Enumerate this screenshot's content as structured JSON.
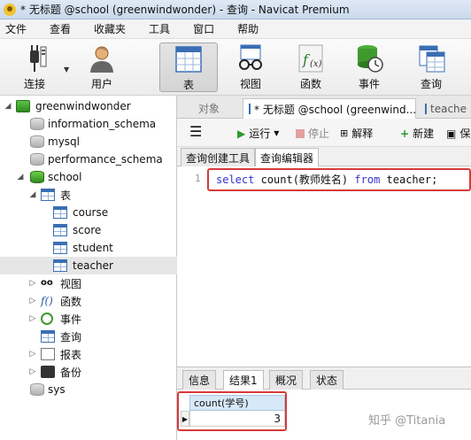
{
  "window": {
    "title": "* 无标题 @school (greenwindwonder) - 查询 - Navicat Premium"
  },
  "menu": [
    "文件",
    "查看",
    "收藏夹",
    "工具",
    "窗口",
    "帮助"
  ],
  "toolbar": {
    "items": [
      {
        "label": "连接",
        "icon": "plug-icon"
      },
      {
        "label": "用户",
        "icon": "user-icon"
      },
      {
        "label": "表",
        "icon": "table-icon"
      },
      {
        "label": "视图",
        "icon": "view-glasses-icon"
      },
      {
        "label": "函数",
        "icon": "function-icon"
      },
      {
        "label": "事件",
        "icon": "event-icon"
      },
      {
        "label": "查询",
        "icon": "query-icon"
      }
    ],
    "active": "表"
  },
  "tree": {
    "connection": "greenwindwonder",
    "databases_top": [
      "information_schema",
      "mysql",
      "performance_schema"
    ],
    "school": "school",
    "tables_label": "表",
    "tables": [
      "course",
      "score",
      "student",
      "teacher"
    ],
    "selected_table": "teacher",
    "sub_nodes": [
      "视图",
      "函数",
      "事件",
      "查询",
      "报表",
      "备份"
    ],
    "databases_bottom": [
      "sys"
    ]
  },
  "tabs": {
    "objects": "对象",
    "query_tab": "* 无标题 @school (greenwind...",
    "teacher_tab": "teache"
  },
  "query_toolbar": {
    "run": "运行",
    "stop": "停止",
    "explain": "解释",
    "new": "新建",
    "save": "保"
  },
  "subtabs": {
    "builder": "查询创建工具",
    "editor": "查询编辑器"
  },
  "editor": {
    "line_number": "1",
    "kw_select": "select",
    "expr": " count(教师姓名) ",
    "kw_from": "from",
    "table": " teacher;"
  },
  "result_tabs": [
    "信息",
    "结果1",
    "概况",
    "状态"
  ],
  "active_result_tab": "结果1",
  "result_grid": {
    "header": "count(学号)",
    "value": "3"
  },
  "watermark": "知乎 @Titania"
}
